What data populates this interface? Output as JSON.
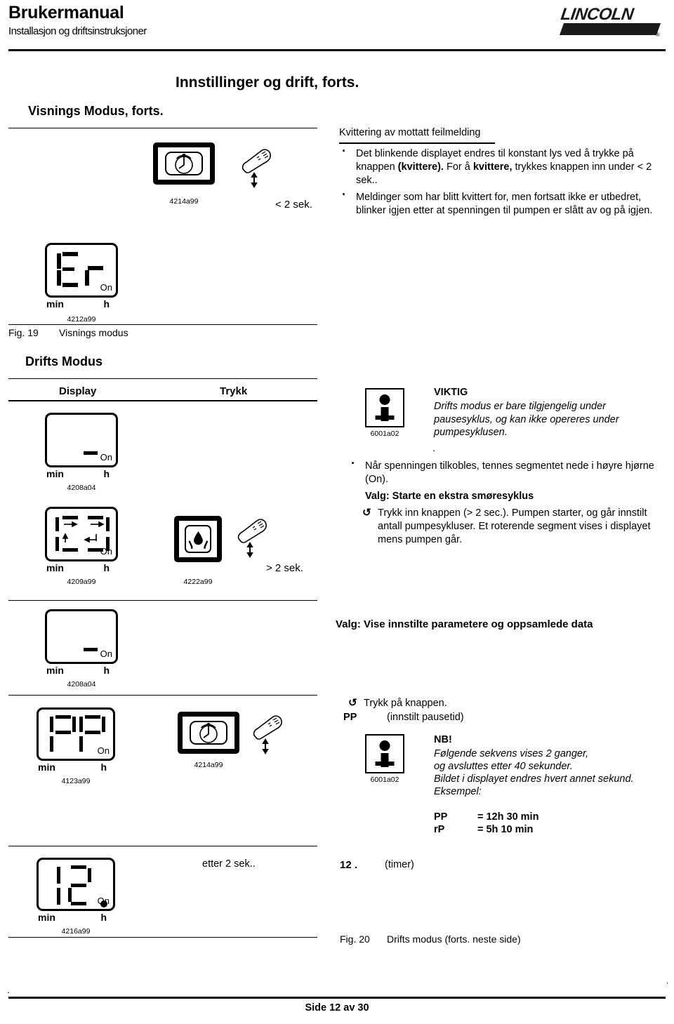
{
  "header": {
    "title": "Brukermanual",
    "subtitle": "Installasjon og driftsinstruksjoner",
    "logo_text": "LINCOLN",
    "logo_mark": "®"
  },
  "page_title": "Innstillinger og drift, forts.",
  "visnings_section": {
    "heading": "Visnings Modus, forts.",
    "button_fig_code": "4214a99",
    "press_duration": "< 2 sek.",
    "right_heading": "Kvittering av mottatt feilmelding",
    "bullets": [
      {
        "part1": "Det blinkende displayet endres til konstant lys ved å trykke på knappen ",
        "bold1": "(kvittere).",
        "part2": " For å ",
        "bold2": "kvittere,",
        "part3": " trykkes knappen inn under < 2 sek.."
      },
      {
        "part1": "Meldinger som har blitt kvittert for, men fortsatt ikke er utbedret, blinker igjen etter at spenningen til pumpen er slått av og på igjen.",
        "bold1": "",
        "part2": "",
        "bold2": "",
        "part3": ""
      }
    ],
    "lcd_fig_code": "4212a99",
    "lcd_value": "Er",
    "lcd_min": "min",
    "lcd_h": "h",
    "lcd_on": "On",
    "fig_label": "Fig. 19",
    "fig_caption": "Visnings modus"
  },
  "drifts_section": {
    "heading": "Drifts Modus",
    "col_display": "Display",
    "col_trykk": "Trykk",
    "lcd1_fig_code": "4208a04",
    "lcd2_fig_code": "4209a99",
    "button_fig_code": "4222a99",
    "press_duration": "> 2 sek.",
    "info_fig_code": "6001a02",
    "viktig_title": "VIKTIG",
    "viktig_body": "Drifts modus er bare tilgjengelig under pausesyklus, og kan ikke opereres under pumpesyklusen.",
    "viktig_trailing_dot": ".",
    "bullet_spenning": "Når spenningen tilkobles, tennes segmentet nede i høyre hjørne (On).",
    "valg_ekstra": "Valg: Starte en ekstra smøresyklus",
    "trykk_inn": "Trykk inn knappen (> 2 sec.). Pumpen starter, og går innstilt antall pumpesykluser. Et roterende segment vises i displayet mens pumpen går.",
    "valg_vise": "Valg: Vise innstilte parametere og oppsamlede data"
  },
  "param_section": {
    "lcd1_fig_code": "4208a04",
    "lcd2_fig_code": "4123a99",
    "lcd2_value": "PP",
    "button_fig_code": "4214a99",
    "trykk_knappen": "Trykk på knappen.",
    "pp_label": "PP",
    "pp_desc": "(innstilt pausetid)",
    "info_fig_code": "6001a02",
    "nb_title": "NB!",
    "nb_lines": [
      "Følgende sekvens vises 2 ganger,",
      "og avsluttes etter 40 sekunder.",
      "Bildet i displayet endres hvert annet sekund.",
      "Eksempel:"
    ],
    "examples": [
      {
        "key": "PP",
        "value": "= 12h 30 min"
      },
      {
        "key": "rP",
        "value": "= 5h 10 min"
      }
    ]
  },
  "timer_section": {
    "lcd_fig_code": "4216a99",
    "lcd_value": "12",
    "etter": "etter 2 sek..",
    "value_label": "12 .",
    "unit_label": "(timer)",
    "fig_label": "Fig. 20",
    "fig_caption": "Drifts modus (forts. neste side)"
  },
  "lcd_labels": {
    "min": "min",
    "h": "h",
    "on": "On"
  },
  "footer": {
    "page_text": "Side 12 av 30",
    "dot_left": ".",
    "dot_right": "."
  },
  "icons": {
    "clock_button": "clock-button-icon",
    "drop_button": "lubrication-drop-button-icon",
    "finger": "finger-press-icon",
    "info": "info-icon"
  },
  "colors": {
    "ink": "#000000",
    "paper": "#ffffff"
  }
}
